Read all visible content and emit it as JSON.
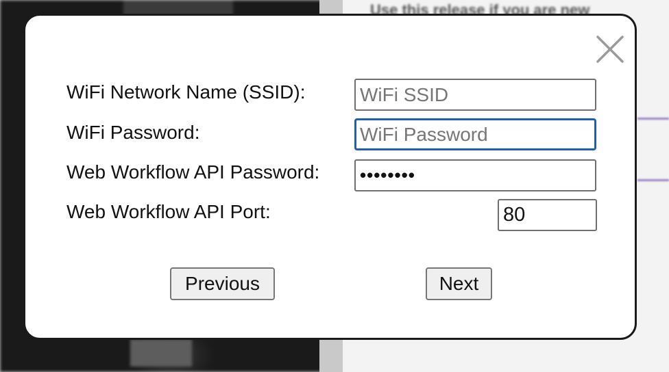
{
  "background": {
    "heading": "Use this release if you are new"
  },
  "modal": {
    "close_icon": "close-icon",
    "fields": {
      "ssid": {
        "label": "WiFi Network Name (SSID):",
        "placeholder": "WiFi SSID",
        "value": ""
      },
      "wifi_password": {
        "label": "WiFi Password:",
        "placeholder": "WiFi Password",
        "value": ""
      },
      "api_password": {
        "label": "Web Workflow API Password:",
        "value": "••••••••"
      },
      "api_port": {
        "label": "Web Workflow API Port:",
        "value": "80"
      }
    },
    "buttons": {
      "previous": "Previous",
      "next": "Next"
    }
  },
  "colors": {
    "focus_border": "#1f5fb0",
    "modal_border": "#1a1a1a",
    "accent_rule": "#9b84c4"
  }
}
